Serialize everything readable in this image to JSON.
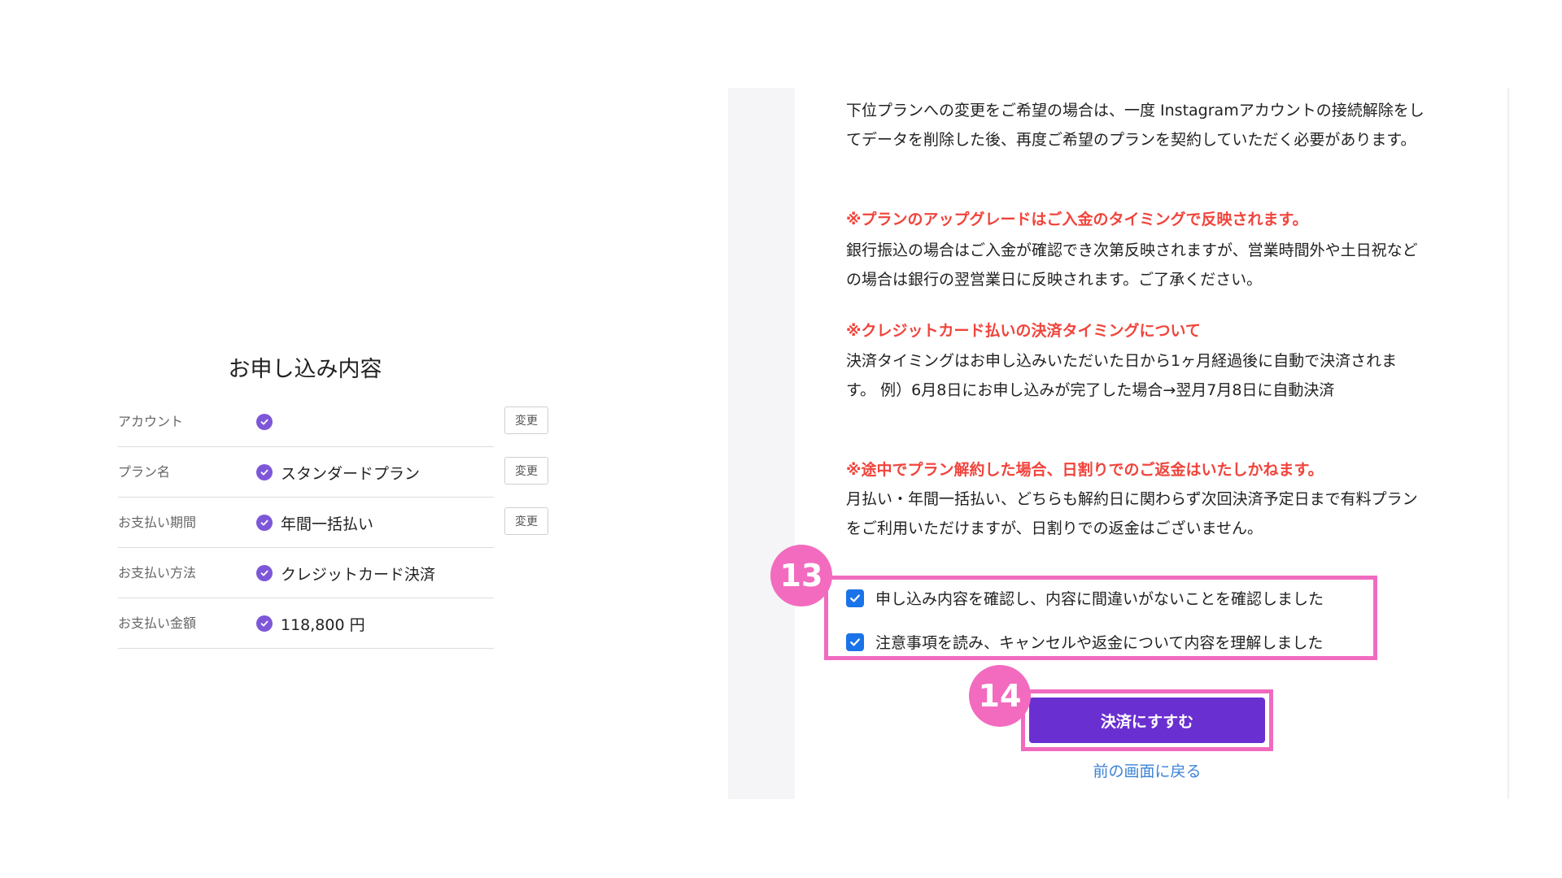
{
  "summary": {
    "title": "お申し込み内容",
    "change_label": "変更",
    "rows": [
      {
        "label": "アカウント",
        "value": "",
        "has_change": true
      },
      {
        "label": "プラン名",
        "value": "スタンダードプラン",
        "has_change": true
      },
      {
        "label": "お支払い期間",
        "value": "年間一括払い",
        "has_change": true
      },
      {
        "label": "お支払い方法",
        "value": "クレジットカード決済",
        "has_change": false
      },
      {
        "label": "お支払い金額",
        "value": "118,800 円",
        "has_change": false
      }
    ]
  },
  "notices": {
    "intro_line1": "下位プランへの変更をご希望の場合は、一度 Instagramアカウントの接続解除をし",
    "intro_line2": "てデータを削除した後、再度ご希望のプランを契約していただく必要があります。",
    "upgrade_head": "※プランのアップグレードはご入金のタイミングで反映されます。",
    "upgrade_line1": "銀行振込の場合はご入金が確認でき次第反映されますが、営業時間外や土日祝など",
    "upgrade_line2": "の場合は銀行の翌営業日に反映されます。ご了承ください。",
    "card_head": "※クレジットカード払いの決済タイミングについて",
    "card_line1": "決済タイミングはお申し込みいただいた日から1ヶ月経過後に自動で決済されま",
    "card_line2": "す。 例）6月8日にお申し込みが完了した場合→翌月7月8日に自動決済",
    "refund_head": "※途中でプラン解約した場合、日割りでのご返金はいたしかねます。",
    "refund_line1": "月払い・年間一括払い、どちらも解約日に関わらず次回決済予定日まで有料プラン",
    "refund_line2": "をご利用いただけますが、日割りでの返金はございません。"
  },
  "agreements": {
    "confirm_label": "申し込み内容を確認し、内容に間違いがないことを確認しました",
    "confirm_checked": true,
    "cancel_label": "注意事項を読み、キャンセルや返金について内容を理解しました",
    "cancel_checked": true
  },
  "badges": {
    "step13": "13",
    "step14": "14"
  },
  "actions": {
    "pay_label": "決済にすすむ",
    "back_label": "前の画面に戻る"
  },
  "colors": {
    "accent_purple": "#6a2fd1",
    "check_purple": "#7e57d9",
    "notice_red": "#f0443c",
    "highlight_pink": "#f06bc0",
    "checkbox_blue": "#1a73e8",
    "link_blue": "#3b82d6"
  },
  "icons": {
    "row_check": "check-circle-icon",
    "agree_check": "checkbox-checked-icon"
  }
}
